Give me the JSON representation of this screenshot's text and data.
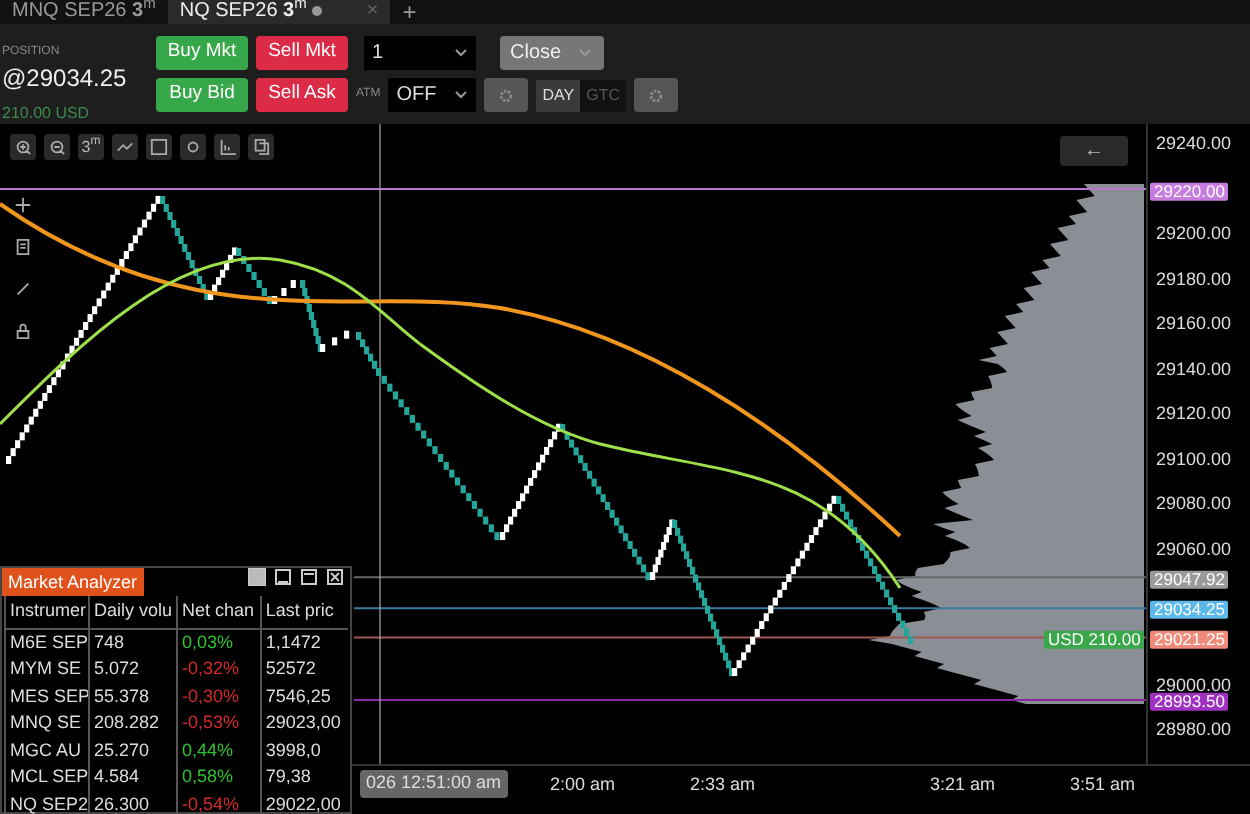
{
  "tabs": [
    {
      "label": "MNQ SEP26 **3**$^{m}$",
      "selected": false
    },
    {
      "label": "NQ SEP26 **3**$^{m}$",
      "selected": true,
      "close": "×"
    }
  ],
  "new_tab": "+",
  "position": {
    "label": "POSITION",
    "price": "@29034.25",
    "pnl": "210.00 USD"
  },
  "order_buttons": [
    {
      "label": "Buy Mkt",
      "kind": "buy"
    },
    {
      "label": "Sell Mkt",
      "kind": "sell"
    },
    {
      "label": "Buy Bid",
      "kind": "buy"
    },
    {
      "label": "Sell Ask",
      "kind": "sell"
    }
  ],
  "quantity": "1",
  "close_button": "Close",
  "atm": {
    "label": "ATM",
    "value": "OFF"
  },
  "time_in_force": [
    {
      "label": "DAY",
      "selected": true
    },
    {
      "label": "GTC",
      "selected": false
    }
  ],
  "chart_toolbar": {
    "interval": "3$^{m}$",
    "back": "←"
  },
  "price_axis": {
    "ticks": [
      "29240.00",
      "29200.00",
      "29180.00",
      "29160.00",
      "29140.00",
      "29120.00",
      "29100.00",
      "29080.00",
      "29060.00",
      "29000.00",
      "28980.00"
    ],
    "markers": [
      {
        "label": "29220.00",
        "color": "#c77de0"
      },
      {
        "label": "29047.92",
        "color": "#9a9a9a"
      },
      {
        "label": "29034.25",
        "color": "#5bb8e8"
      },
      {
        "label": "29021.25",
        "color": "#f08a7a"
      },
      {
        "label": "28993.50",
        "color": "#a030c0"
      }
    ]
  },
  "pnl_tag": "USD 210.00",
  "time_axis": {
    "cursor": "026 12:51:00 am",
    "labels": [
      "2:00 am",
      "2:33 am",
      "3:21 am",
      "3:51 am"
    ]
  },
  "market_analyzer": {
    "title": "Market Analyzer",
    "columns": [
      "Instrumer",
      "Daily volu",
      "Net chan",
      "Last pric"
    ],
    "rows": [
      {
        "instrument": "M6E SEP",
        "volume": "748",
        "change": "0,03%",
        "color": "#2ec42e",
        "last": "1,1472"
      },
      {
        "instrument": "MYM SE",
        "volume": "5.072",
        "change": "-0,32%",
        "color": "#d42a2a",
        "last": "52572"
      },
      {
        "instrument": "MES SEP",
        "volume": "55.378",
        "change": "-0,30%",
        "color": "#d42a2a",
        "last": "7546,25"
      },
      {
        "instrument": "MNQ SE",
        "volume": "208.282",
        "change": "-0,53%",
        "color": "#d42a2a",
        "last": "29023,00"
      },
      {
        "instrument": "MGC AU",
        "volume": "25.270",
        "change": "0,44%",
        "color": "#2ec42e",
        "last": "3998,0"
      },
      {
        "instrument": "MCL SEP",
        "volume": "4.584",
        "change": "0,58%",
        "color": "#2ec42e",
        "last": "79,38"
      },
      {
        "instrument": "NQ SEP2",
        "volume": "26.300",
        "change": "-0,54%",
        "color": "#d42a2a",
        "last": "29022,00"
      }
    ]
  }
}
